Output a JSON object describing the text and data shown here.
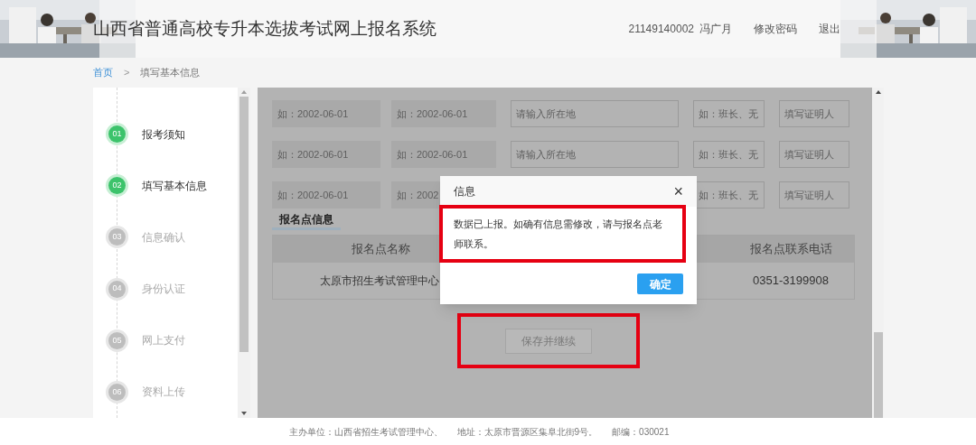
{
  "header": {
    "title": "山西省普通高校专升本选拔考试网上报名系统",
    "user_id": "21149140002",
    "user_name": "冯广月",
    "links": [
      "修改密码",
      "退出"
    ]
  },
  "breadcrumb": {
    "home": "首页",
    "separator": ">",
    "current": "填写基本信息"
  },
  "steps": [
    {
      "number": "01",
      "label": "报考须知",
      "done": true
    },
    {
      "number": "02",
      "label": "填写基本信息",
      "done": true
    },
    {
      "number": "03",
      "label": "信息确认",
      "done": false
    },
    {
      "number": "04",
      "label": "身份认证",
      "done": false
    },
    {
      "number": "05",
      "label": "网上支付",
      "done": false
    },
    {
      "number": "06",
      "label": "资料上传",
      "done": false
    }
  ],
  "experience_rows": [
    [
      {
        "kind": "date",
        "placeholder": "如：2002-06-01"
      },
      {
        "kind": "date",
        "placeholder": "如：2002-06-01"
      },
      {
        "kind": "location",
        "placeholder": "请输入所在地"
      },
      {
        "kind": "role",
        "placeholder": "如：班长、无"
      },
      {
        "kind": "witness",
        "placeholder": "填写证明人"
      }
    ],
    [
      {
        "kind": "date",
        "placeholder": "如：2002-06-01"
      },
      {
        "kind": "date",
        "placeholder": "如：2002-06-01"
      },
      {
        "kind": "location",
        "placeholder": "请输入所在地"
      },
      {
        "kind": "role",
        "placeholder": "如：班长、无"
      },
      {
        "kind": "witness",
        "placeholder": "填写证明人"
      }
    ],
    [
      {
        "kind": "date",
        "placeholder": "如：2002-06-01"
      },
      {
        "kind": "date",
        "placeholder": "如：2002"
      },
      {
        "kind": "location"
      },
      {
        "kind": "role",
        "placeholder": "如：班长、无"
      },
      {
        "kind": "witness",
        "placeholder": "填写证明人"
      }
    ]
  ],
  "site_section": {
    "title": "报名点信息",
    "columns": [
      "报名点名称",
      "报名点联系电话"
    ],
    "row": [
      "太原市招生考试管理中心",
      "0351-3199908"
    ]
  },
  "save_button": {
    "label": "保存并继续",
    "disabled": true
  },
  "dialog": {
    "title": "信息",
    "close": "×",
    "message": "数据已上报。如确有信息需修改，请与报名点老师联系。",
    "ok": "确定"
  },
  "footer": [
    "主办单位：山西省招生考试管理中心、",
    "地址：太原市晋源区集阜北街9号。",
    "邮编：030021"
  ]
}
